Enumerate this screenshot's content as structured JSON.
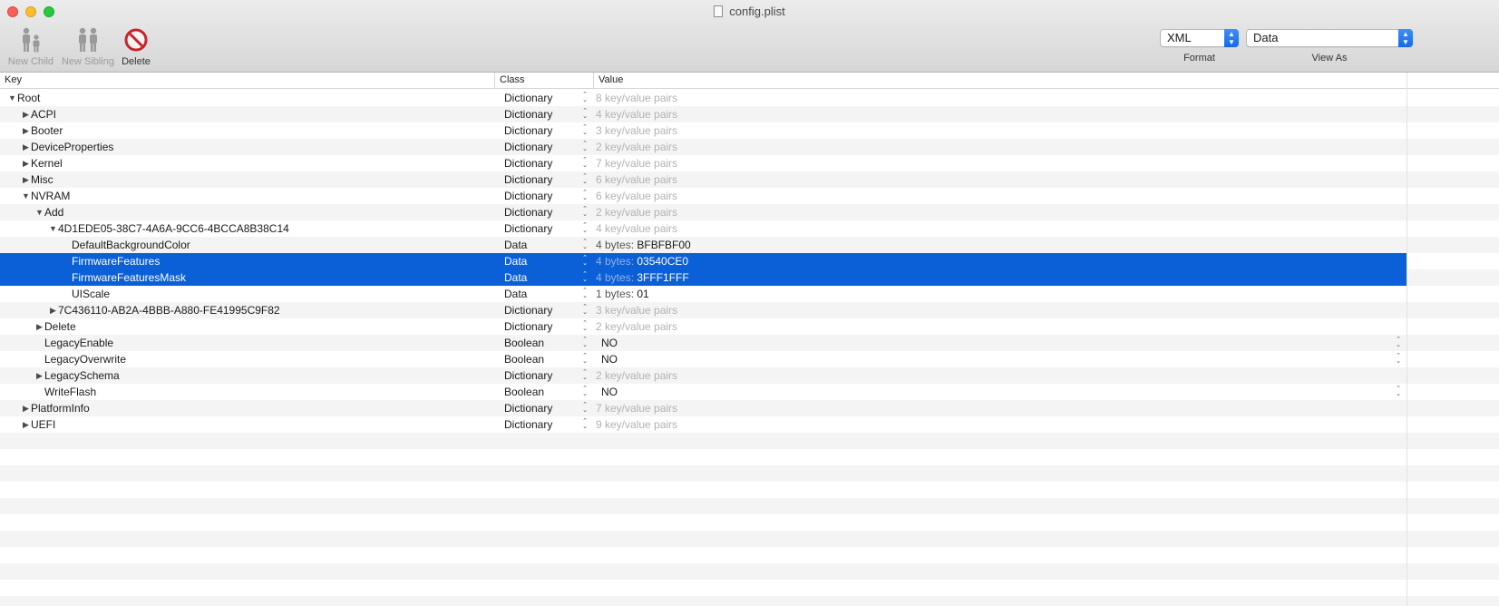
{
  "window": {
    "title": "config.plist"
  },
  "toolbar": {
    "new_child_label": "New Child",
    "new_sibling_label": "New Sibling",
    "delete_label": "Delete",
    "format": {
      "value": "XML",
      "caption": "Format"
    },
    "view_as": {
      "value": "Data",
      "caption": "View As"
    }
  },
  "columns": {
    "key": "Key",
    "class": "Class",
    "value": "Value"
  },
  "colors": {
    "selection": "#0b5fd7",
    "close": "#fc5f57",
    "minimize": "#fdbc2e",
    "zoom": "#28c840"
  },
  "rows": [
    {
      "key": "Root",
      "class": "Dictionary",
      "value": "8 key/value pairs",
      "kind": "dict",
      "disclosure": "open",
      "depth": 0
    },
    {
      "key": "ACPI",
      "class": "Dictionary",
      "value": "4 key/value pairs",
      "kind": "dict",
      "disclosure": "closed",
      "depth": 1
    },
    {
      "key": "Booter",
      "class": "Dictionary",
      "value": "3 key/value pairs",
      "kind": "dict",
      "disclosure": "closed",
      "depth": 1
    },
    {
      "key": "DeviceProperties",
      "class": "Dictionary",
      "value": "2 key/value pairs",
      "kind": "dict",
      "disclosure": "closed",
      "depth": 1
    },
    {
      "key": "Kernel",
      "class": "Dictionary",
      "value": "7 key/value pairs",
      "kind": "dict",
      "disclosure": "closed",
      "depth": 1
    },
    {
      "key": "Misc",
      "class": "Dictionary",
      "value": "6 key/value pairs",
      "kind": "dict",
      "disclosure": "closed",
      "depth": 1
    },
    {
      "key": "NVRAM",
      "class": "Dictionary",
      "value": "6 key/value pairs",
      "kind": "dict",
      "disclosure": "open",
      "depth": 1
    },
    {
      "key": "Add",
      "class": "Dictionary",
      "value": "2 key/value pairs",
      "kind": "dict",
      "disclosure": "open",
      "depth": 2
    },
    {
      "key": "4D1EDE05-38C7-4A6A-9CC6-4BCCA8B38C14",
      "class": "Dictionary",
      "value": "4 key/value pairs",
      "kind": "dict",
      "disclosure": "open",
      "depth": 3
    },
    {
      "key": "DefaultBackgroundColor",
      "class": "Data",
      "value_prefix": "4 bytes:",
      "value": "BFBFBF00",
      "kind": "data",
      "disclosure": "none",
      "depth": 4
    },
    {
      "key": "FirmwareFeatures",
      "class": "Data",
      "value_prefix": "4 bytes:",
      "value": "03540CE0",
      "kind": "data",
      "disclosure": "none",
      "depth": 4,
      "selected": true
    },
    {
      "key": "FirmwareFeaturesMask",
      "class": "Data",
      "value_prefix": "4 bytes:",
      "value": "3FFF1FFF",
      "kind": "data",
      "disclosure": "none",
      "depth": 4,
      "selected": true
    },
    {
      "key": "UIScale",
      "class": "Data",
      "value_prefix": "1 bytes:",
      "value": "01",
      "kind": "data",
      "disclosure": "none",
      "depth": 4
    },
    {
      "key": "7C436110-AB2A-4BBB-A880-FE41995C9F82",
      "class": "Dictionary",
      "value": "3 key/value pairs",
      "kind": "dict",
      "disclosure": "closed",
      "depth": 3
    },
    {
      "key": "Delete",
      "class": "Dictionary",
      "value": "2 key/value pairs",
      "kind": "dict",
      "disclosure": "closed",
      "depth": 2
    },
    {
      "key": "LegacyEnable",
      "class": "Boolean",
      "value": "NO",
      "kind": "bool",
      "disclosure": "none",
      "depth": 2
    },
    {
      "key": "LegacyOverwrite",
      "class": "Boolean",
      "value": "NO",
      "kind": "bool",
      "disclosure": "none",
      "depth": 2
    },
    {
      "key": "LegacySchema",
      "class": "Dictionary",
      "value": "2 key/value pairs",
      "kind": "dict",
      "disclosure": "closed",
      "depth": 2
    },
    {
      "key": "WriteFlash",
      "class": "Boolean",
      "value": "NO",
      "kind": "bool",
      "disclosure": "none",
      "depth": 2
    },
    {
      "key": "PlatformInfo",
      "class": "Dictionary",
      "value": "7 key/value pairs",
      "kind": "dict",
      "disclosure": "closed",
      "depth": 1
    },
    {
      "key": "UEFI",
      "class": "Dictionary",
      "value": "9 key/value pairs",
      "kind": "dict",
      "disclosure": "closed",
      "depth": 1
    }
  ]
}
